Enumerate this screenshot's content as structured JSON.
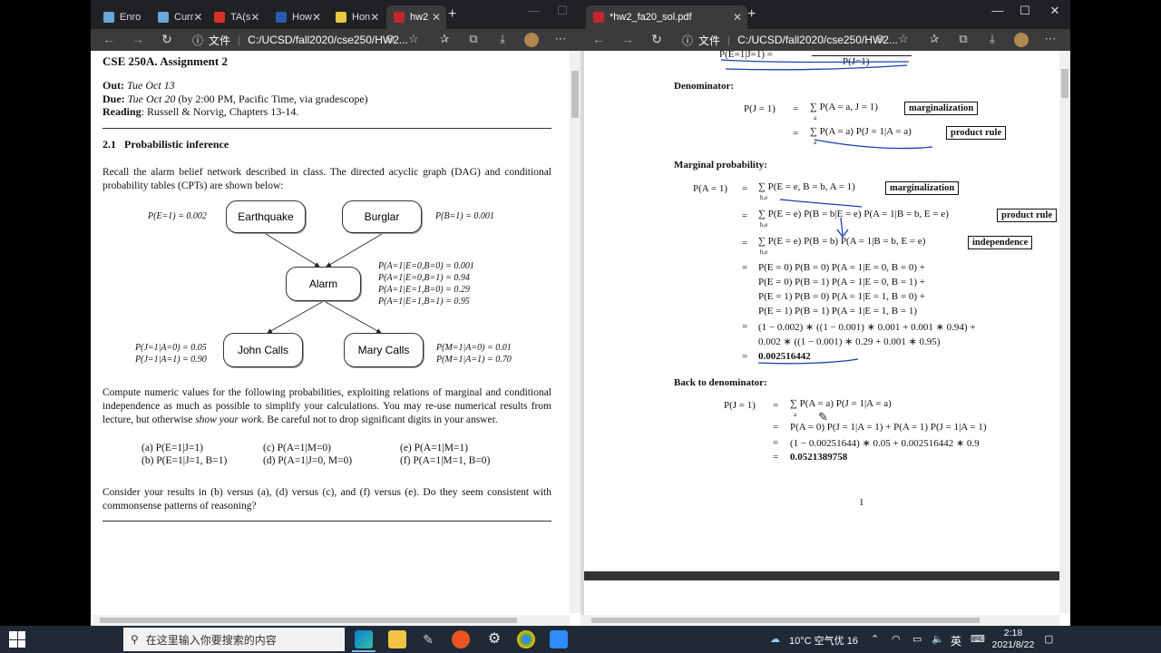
{
  "left_window": {
    "tabs": [
      {
        "label": "Enro",
        "color": "#6aa7d8"
      },
      {
        "label": "Curr",
        "color": "#6aa7d8"
      },
      {
        "label": "TA(s",
        "color": "#d93025"
      },
      {
        "label": "How",
        "color": "#2a5db0"
      },
      {
        "label": "Hon",
        "color": "#e8c840"
      },
      {
        "label": "hw2",
        "color": "#c4262e"
      }
    ],
    "address_label": "文件",
    "url": "C:/UCSD/fall2020/cse250/HW2...",
    "doc": {
      "title": "CSE 250A. Assignment 2",
      "out_label": "Out:",
      "out_value": "Tue Oct 13",
      "due_label": "Due:",
      "due_date": "Tue Oct 20",
      "due_note": "(by 2:00 PM, Pacific Time, via gradescope)",
      "reading_label": "Reading",
      "reading_value": ": Russell & Norvig, Chapters 13-14.",
      "section_num": "2.1",
      "section_title": "Probabilistic inference",
      "para1": "Recall the alarm belief network described in class.  The directed acyclic graph (DAG) and conditional probability tables (CPTs) are shown below:",
      "nodes": {
        "earthquake": "Earthquake",
        "burglar": "Burglar",
        "alarm": "Alarm",
        "john": "John Calls",
        "mary": "Mary Calls"
      },
      "cpts": {
        "pe": "P(E=1) = 0.002",
        "pb": "P(B=1) = 0.001",
        "pa": [
          "P(A=1|E=0,B=0) = 0.001",
          "P(A=1|E=0,B=1) = 0.94",
          "P(A=1|E=1,B=0) = 0.29",
          "P(A=1|E=1,B=1) = 0.95"
        ],
        "pj": [
          "P(J=1|A=0) = 0.05",
          "P(J=1|A=1) = 0.90"
        ],
        "pm": [
          "P(M=1|A=0) = 0.01",
          "P(M=1|A=1) = 0.70"
        ]
      },
      "para2a": "Compute numeric values for the following probabilities, exploiting relations of marginal and conditional independence as much as possible to simplify your calculations.  You may re-use numerical results from lecture, but otherwise ",
      "para2b": "show your work",
      "para2c": ".  Be careful not to drop significant digits in your answer.",
      "questions": [
        "(a) P(E=1|J=1)",
        "(b) P(E=1|J=1, B=1)",
        "(c) P(A=1|M=0)",
        "(d) P(A=1|J=0, M=0)",
        "(e) P(A=1|M=1)",
        "(f) P(A=1|M=1, B=0)"
      ],
      "para3": "Consider your results in (b) versus (a), (d) versus (c), and (f) versus (e).  Do they seem consistent with commonsense patterns of reasoning?"
    }
  },
  "right_window": {
    "tab_label": "*hw2_fa20_sol.pdf",
    "address_label": "文件",
    "url": "C:/UCSD/fall2020/cse250/HW2...",
    "top_fragment": "P(E=1|J=1)  =",
    "top_fragment_den": "P(J=1)",
    "denominator_heading": "Denominator:",
    "den_lhs": "P(J = 1)",
    "eq": "=",
    "den1": "∑ P(A = a, J = 1)",
    "den2": "∑ P(A = a) P(J = 1|A = a)",
    "sub_a": "a",
    "box_marg": "marginalization",
    "box_prod": "product rule",
    "box_indep": "independence",
    "marg_heading": "Marginal probability:",
    "marg_lhs": "P(A = 1)",
    "sub_be": "b,e",
    "m1": "∑ P(E = e, B = b, A = 1)",
    "m2": "∑ P(E = e) P(B = b|E = e) P(A = 1|B = b, E = e)",
    "m3": "∑ P(E = e) P(B = b) P(A = 1|B = b, E = e)",
    "m4": [
      "P(E = 0) P(B = 0) P(A = 1|E = 0, B = 0)  +",
      "P(E = 0) P(B = 1) P(A = 1|E = 0, B = 1)  +",
      "P(E = 1) P(B = 0) P(A = 1|E = 1, B = 0)  +",
      "P(E = 1) P(B = 1) P(A = 1|E = 1, B = 1)"
    ],
    "m5": [
      "(1 − 0.002) ∗ ((1 − 0.001) ∗ 0.001 + 0.001 ∗ 0.94)  +",
      "0.002 ∗ ((1 − 0.001) ∗ 0.29 + 0.001 ∗ 0.95)"
    ],
    "m6": "0.002516442",
    "back_heading": "Back to denominator:",
    "b1": "∑ P(A = a) P(J = 1|A = a)",
    "b2": "P(A = 0) P(J = 1|A = 1) + P(A = 1) P(J = 1|A = 1)",
    "b3": "(1 − 0.00251644) ∗ 0.05 + 0.002516442 ∗ 0.9",
    "b4": "0.0521389758",
    "page_num": "1"
  },
  "taskbar": {
    "search_placeholder": "在这里输入你要搜索的内容",
    "weather": "10°C 空气优 16",
    "ime": "英",
    "time": "2:18",
    "date": "2021/8/22"
  }
}
